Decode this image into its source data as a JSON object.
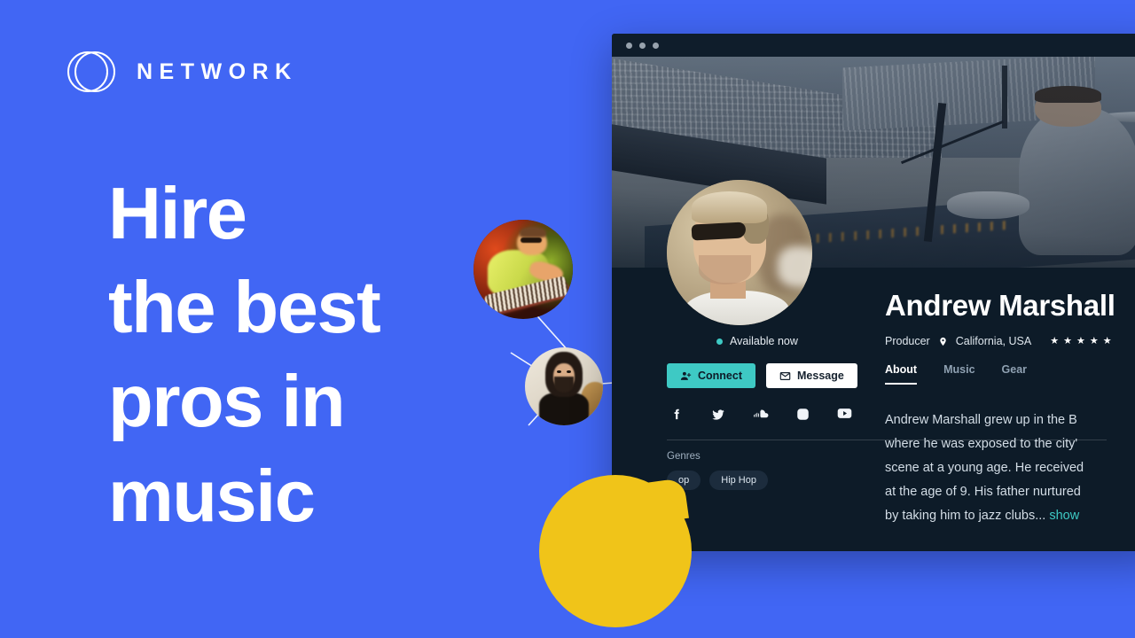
{
  "brand": {
    "name": "NETWORK",
    "logo_icon": "two-overlapping-circles-icon"
  },
  "hero_headline": {
    "lines": [
      "Hire",
      "the best",
      "pros in",
      "music"
    ]
  },
  "colors": {
    "background_blue": "#4166f4",
    "card_dark": "#0d1b28",
    "accent_teal": "#3ec9c4",
    "bubble_yellow": "#f0c419",
    "text_white": "#ffffff"
  },
  "network_nodes": [
    {
      "name": "node-avatar-keyboardist",
      "alt": "musician playing a keytar under stage lights"
    },
    {
      "name": "node-avatar-guitarist",
      "alt": "long-haired musician holding a guitar"
    }
  ],
  "window": {
    "traffic_lights": [
      "dot",
      "dot",
      "dot"
    ],
    "hero_image_alt": "drummer seated behind a drum kit on stage in an empty stadium",
    "profile": {
      "avatar_alt": "man wearing sunglasses and a white t-shirt",
      "availability": {
        "status": "Available now",
        "dot_color": "#3ec9c4"
      },
      "name": "Andrew Marshall",
      "role": "Producer",
      "location": "California, USA",
      "location_icon": "map-pin-icon",
      "rating_stars": 5,
      "star_glyph": "★",
      "buttons": [
        {
          "label": "Connect",
          "icon": "person-add-icon",
          "style": "primary"
        },
        {
          "label": "Message",
          "icon": "envelope-icon",
          "style": "secondary"
        }
      ],
      "socials": [
        {
          "name": "facebook-icon"
        },
        {
          "name": "twitter-icon"
        },
        {
          "name": "soundcloud-icon"
        },
        {
          "name": "instagram-icon"
        },
        {
          "name": "youtube-icon"
        }
      ],
      "tabs": [
        {
          "label": "About",
          "active": true
        },
        {
          "label": "Music",
          "active": false
        },
        {
          "label": "Gear",
          "active": false
        }
      ],
      "bio_lines": [
        "Andrew Marshall grew up in the B",
        "where he was exposed to the city'",
        "scene at a young age. He received",
        "at the age of 9. His father nurtured",
        "by taking him to jazz clubs..."
      ],
      "bio_more_label": "show",
      "genres_label": "Genres",
      "genre_tags": [
        "op",
        "Hip Hop"
      ]
    }
  },
  "bubble": {
    "text": "!!!",
    "marks": 3
  }
}
